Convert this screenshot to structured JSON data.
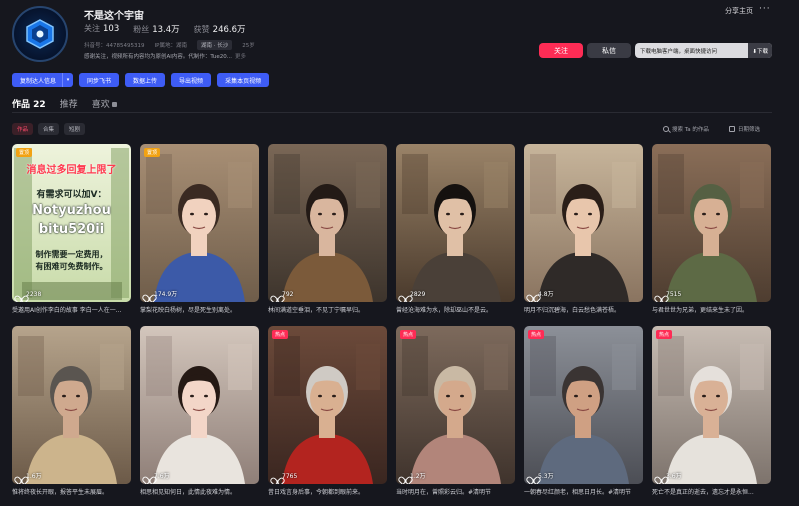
{
  "profile": {
    "name": "不是这个宇宙",
    "stats": [
      {
        "label": "关注",
        "value": "103"
      },
      {
        "label": "粉丝",
        "value": "13.4万"
      },
      {
        "label": "获赞",
        "value": "246.6万"
      }
    ],
    "douyin_id": "抖音号：44785495319",
    "ip": "IP属地：湖南",
    "tag": "湖南 · 长沙",
    "age": "25岁",
    "bio": "感谢关注，视频所有内容均为原创AI内容。代制作：Tue20...",
    "bio_more": "更多"
  },
  "header_right": {
    "share": "分享主页",
    "more": "···",
    "follow": "关注",
    "message": "私信",
    "download_banner": "下载电脑客户端，桌面快捷访问",
    "download_button": "⬇下载"
  },
  "action_buttons": [
    "复制达人信息",
    "同步飞书",
    "数据上传",
    "导出视频",
    "采集本页视频"
  ],
  "tabs": [
    {
      "label": "作品 22"
    },
    {
      "label": "推荐"
    },
    {
      "label": "喜欢"
    }
  ],
  "subtabs": [
    "作品",
    "合集",
    "短剧"
  ],
  "search_works": "搜索 Ta 的作品",
  "date_filter": "日期筛选",
  "poster": {
    "line1": "消息过多回复上限了",
    "line2": "有需求可以加V：",
    "line3": "Notyuzhou",
    "line4": "bitu520ii",
    "line5": "制作需要一定费用，",
    "line6": "有困难可免费制作。"
  },
  "videos": [
    {
      "badge": "置顶",
      "badge_type": "top",
      "likes": "2238",
      "caption": "受邀用AI创作李白的故事 李白一人在一..."
    },
    {
      "badge": "置顶",
      "badge_type": "top",
      "likes": "174.9万",
      "caption": "掌梨花映白杨树，尽是死生别离处。"
    },
    {
      "badge": "",
      "badge_type": "",
      "likes": "792",
      "caption": "林间满道空垂泪，不见丁宁嘱早归。"
    },
    {
      "badge": "",
      "badge_type": "",
      "likes": "2829",
      "caption": "曾经沧海难为水，除却巫山不是云。"
    },
    {
      "badge": "",
      "badge_type": "",
      "likes": "4.8万",
      "caption": "明月不归沉碧海，白云愁色满苍梧。"
    },
    {
      "badge": "",
      "badge_type": "",
      "likes": "7515",
      "caption": "与君世世为兄弟，更结来生未了因。"
    },
    {
      "badge": "",
      "badge_type": "",
      "likes": "1.6万",
      "caption": "惟将终夜长开眼，报答平生未展眉。"
    },
    {
      "badge": "",
      "badge_type": "",
      "likes": "7.6万",
      "caption": "相思相见知何日，此情此夜难为情。"
    },
    {
      "badge": "热点",
      "badge_type": "hot",
      "likes": "7765",
      "caption": "昔日戏言身后事，今朝都到眼前来。"
    },
    {
      "badge": "热点",
      "badge_type": "hot",
      "likes": "1.2万",
      "caption": "当时明月在，曾照彩云归。#清明节"
    },
    {
      "badge": "热点",
      "badge_type": "hot",
      "likes": "5.3万",
      "caption": "一朝春尽红颜老，相思日月长。#清明节"
    },
    {
      "badge": "热点",
      "badge_type": "hot",
      "likes": "3.6万",
      "caption": "死亡不是真正的逝去，遗忘才是永恒..."
    }
  ],
  "colors": {
    "accent": "#fe2c55",
    "action_blue": "#3e5cf5",
    "badge_top": "#f2a212",
    "background": "#16171e"
  }
}
